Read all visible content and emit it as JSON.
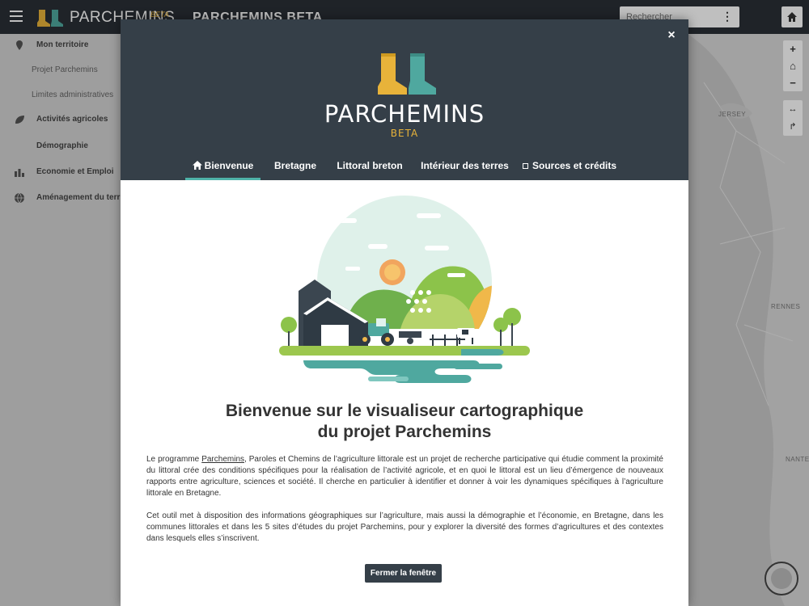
{
  "app": {
    "brand": "PARCHEMINS",
    "brand_beta": "BETA",
    "title": "PARCHEMINS BETA",
    "icons": [
      "menu-icon",
      "home-icon",
      "more-icon"
    ]
  },
  "search": {
    "placeholder": "Rechercher",
    "more": "⋮"
  },
  "sidebar": {
    "items": [
      {
        "label": "Mon territoire",
        "icon": "map-pin-icon"
      },
      {
        "label": "Projet Parchemins"
      },
      {
        "label": "Limites administratives"
      },
      {
        "label": "Activités agricoles",
        "icon": "leaf-icon"
      },
      {
        "label": "Démographie"
      },
      {
        "label": "Economie et Emploi",
        "icon": "bar-chart-icon"
      },
      {
        "label": "Aménagement du territoire",
        "icon": "globe-icon"
      }
    ]
  },
  "map": {
    "labels": [
      "JERSEY",
      "RENNES",
      "NANTES"
    ],
    "zoom_in": "+",
    "zoom_home": "⌂",
    "zoom_out": "−",
    "tool_measure": "↔",
    "tool_share": "↱"
  },
  "modal": {
    "close": "×",
    "brand": "PARCHEMINS",
    "beta": "BETA",
    "tabs": [
      {
        "label": "Bienvenue",
        "icon": "home-icon",
        "active": true
      },
      {
        "label": "Bretagne"
      },
      {
        "label": "Littoral breton"
      },
      {
        "label": "Intérieur des terres"
      },
      {
        "label": "Sources et crédits",
        "icon": "square-icon"
      }
    ],
    "heading_line1": "Bienvenue sur le visualiseur cartographique",
    "heading_line2": "du projet Parchemins",
    "para1": {
      "before": "Le programme ",
      "link": "Parchemins",
      "after": ", Paroles et Chemins de l’agriculture littorale est un projet de recherche participative qui étudie comment la proximité du littoral crée des conditions spécifiques pour la réalisation de l’activité agricole, et en quoi le littoral est un lieu d’émergence de nouveaux rapports entre agriculture, sciences et société. Il cherche en particulier à identifier et donner à voir les dynamiques spécifiques à l’agriculture littorale en Bretagne."
    },
    "para2": "Cet outil met à disposition des informations géographiques sur l’agriculture, mais aussi la démographie et l’économie, en Bretagne, dans les communes littorales et dans les 5 sites d’études du projet Parchemins, pour y explorer la diversité des formes d’agricultures et des contextes dans lesquels elles s’inscrivent.",
    "button": "Fermer la fenêtre"
  },
  "colors": {
    "header": "#353f48",
    "accent": "#4fb3a9",
    "boot_yellow": "#e8b33a",
    "boot_teal": "#4fa89f"
  }
}
